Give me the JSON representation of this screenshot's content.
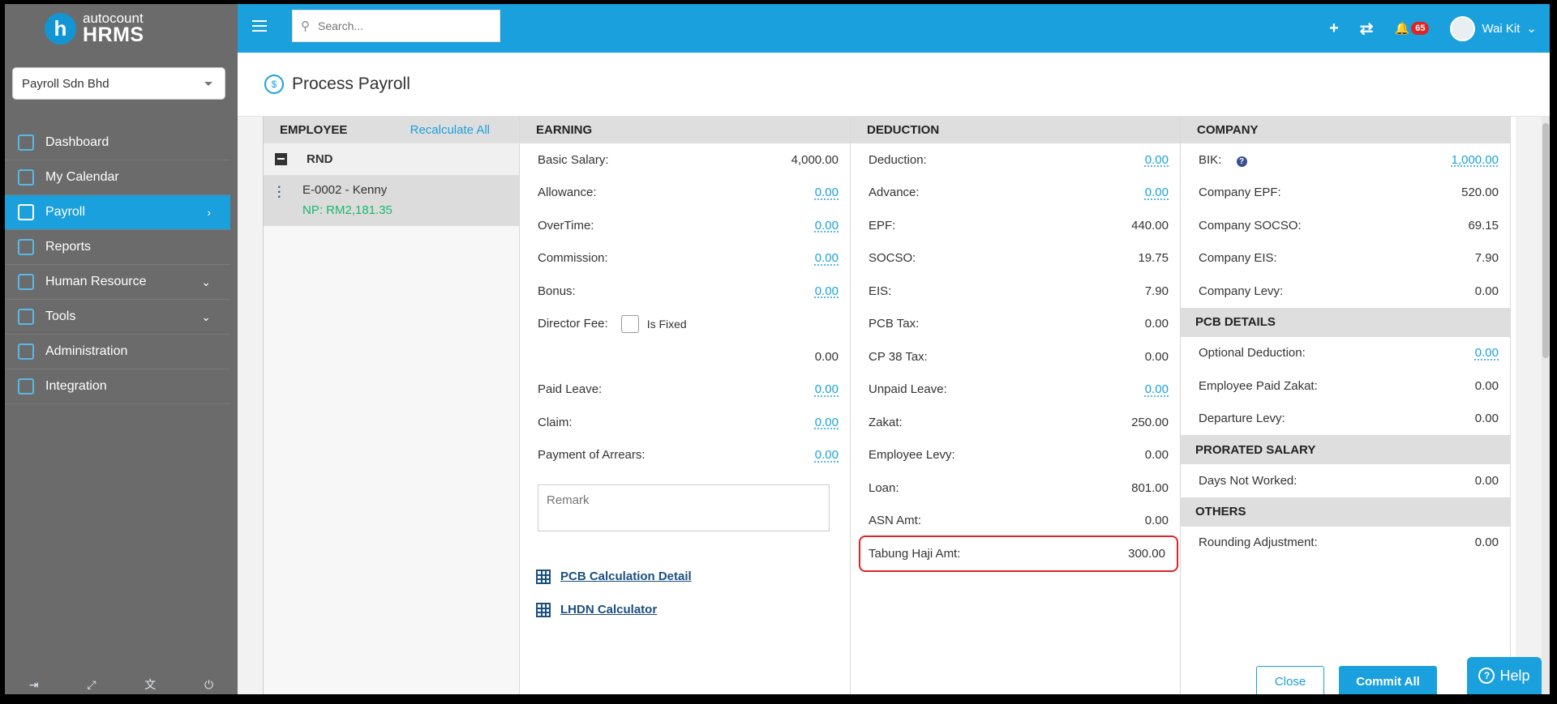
{
  "brand": {
    "logo_letter": "h",
    "top": "autocount",
    "bottom": "HRMS"
  },
  "company_select": {
    "value": "Payroll Sdn Bhd"
  },
  "nav": [
    {
      "label": "Dashboard",
      "icon": "dashboard-icon"
    },
    {
      "label": "My Calendar",
      "icon": "calendar-icon"
    },
    {
      "label": "Payroll",
      "icon": "payroll-icon",
      "active": true,
      "chevron": "›"
    },
    {
      "label": "Reports",
      "icon": "reports-icon"
    },
    {
      "label": "Human Resource",
      "icon": "human-resource-icon",
      "chevron": "⌄"
    },
    {
      "label": "Tools",
      "icon": "tools-icon",
      "chevron": "⌄"
    },
    {
      "label": "Administration",
      "icon": "administration-icon"
    },
    {
      "label": "Integration",
      "icon": "integration-icon"
    }
  ],
  "footer_icons": {
    "logout": "⇥",
    "fullscreen": "⤢",
    "translate": "文",
    "power": "⏻"
  },
  "topbar": {
    "search_placeholder": "Search...",
    "add_icon": "+",
    "sync_icon": "⇄",
    "bell_icon": "🔔",
    "notification_count": "65",
    "user_name": "Wai Kit",
    "user_caret": "⌄"
  },
  "page": {
    "title": "Process Payroll",
    "icon_glyph": "$"
  },
  "employee": {
    "header": "EMPLOYEE",
    "recalculate": "Recalculate All",
    "group": "RND",
    "emp_name": "E-0002 - Kenny",
    "emp_np": "NP: RM2,181.35"
  },
  "earning": {
    "header": "EARNING",
    "rows": [
      {
        "label": "Basic Salary:",
        "value": "4,000.00",
        "link": false
      },
      {
        "label": "Allowance:",
        "value": "0.00",
        "link": true
      },
      {
        "label": "OverTime:",
        "value": "0.00",
        "link": true
      },
      {
        "label": "Commission:",
        "value": "0.00",
        "link": true
      },
      {
        "label": "Bonus:",
        "value": "0.00",
        "link": true
      }
    ],
    "director_fee": "Director Fee:",
    "is_fixed": "Is Fixed",
    "director_value": "0.00",
    "rows2": [
      {
        "label": "Paid Leave:",
        "value": "0.00",
        "link": true
      },
      {
        "label": "Claim:",
        "value": "0.00",
        "link": true
      },
      {
        "label": "Payment of Arrears:",
        "value": "0.00",
        "link": true
      }
    ],
    "remark_placeholder": "Remark",
    "pcb_link": "PCB Calculation Detail",
    "lhdn_link": "LHDN Calculator"
  },
  "deduction": {
    "header": "DEDUCTION",
    "rows": [
      {
        "label": "Deduction:",
        "value": "0.00",
        "link": true
      },
      {
        "label": "Advance:",
        "value": "0.00",
        "link": true
      },
      {
        "label": "EPF:",
        "value": "440.00",
        "link": false
      },
      {
        "label": "SOCSO:",
        "value": "19.75",
        "link": false
      },
      {
        "label": "EIS:",
        "value": "7.90",
        "link": false
      },
      {
        "label": "PCB Tax:",
        "value": "0.00",
        "link": false
      },
      {
        "label": "CP 38 Tax:",
        "value": "0.00",
        "link": false
      },
      {
        "label": "Unpaid Leave:",
        "value": "0.00",
        "link": true
      },
      {
        "label": "Zakat:",
        "value": "250.00",
        "link": false
      },
      {
        "label": "Employee Levy:",
        "value": "0.00",
        "link": false
      },
      {
        "label": "Loan:",
        "value": "801.00",
        "link": false
      },
      {
        "label": "ASN Amt:",
        "value": "0.00",
        "link": false
      }
    ],
    "highlight": {
      "label": "Tabung Haji Amt:",
      "value": "300.00"
    }
  },
  "company": {
    "header": "COMPANY",
    "bik_label": "BIK:",
    "bik_value": "1,000.00",
    "rows": [
      {
        "label": "Company EPF:",
        "value": "520.00"
      },
      {
        "label": "Company SOCSO:",
        "value": "69.15"
      },
      {
        "label": "Company EIS:",
        "value": "7.90"
      },
      {
        "label": "Company Levy:",
        "value": "0.00"
      }
    ],
    "pcb_header": "PCB DETAILS",
    "pcb_rows": [
      {
        "label": "Optional Deduction:",
        "value": "0.00",
        "link": true
      },
      {
        "label": "Employee Paid Zakat:",
        "value": "0.00",
        "link": false
      },
      {
        "label": "Departure Levy:",
        "value": "0.00",
        "link": false
      }
    ],
    "prorated_header": "PRORATED SALARY",
    "prorated_rows": [
      {
        "label": "Days Not Worked:",
        "value": "0.00"
      }
    ],
    "others_header": "OTHERS",
    "others_rows": [
      {
        "label": "Rounding Adjustment:",
        "value": "0.00"
      }
    ]
  },
  "buttons": {
    "close": "Close",
    "commit": "Commit All",
    "help": "Help"
  },
  "colors": {
    "brand_blue": "#1aa0dd",
    "sidebar": "#6b6b6b",
    "np_green": "#18b86b",
    "highlight_red": "#e02424"
  }
}
